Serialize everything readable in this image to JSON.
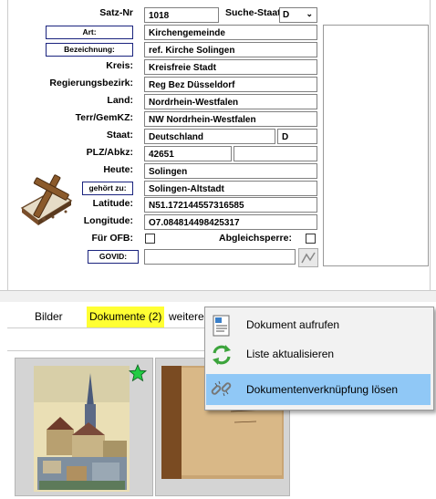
{
  "form": {
    "satznr_label": "Satz-Nr",
    "satznr_value": "1018",
    "suche_label": "Suche-Staat",
    "suche_value": "D",
    "art_button": "Art:",
    "art_value": "Kirchengemeinde",
    "bezeichnung_button": "Bezeichnung:",
    "bezeichnung_value": "ref. Kirche  Solingen",
    "kreis_label": "Kreis:",
    "kreis_value": "Kreisfreie Stadt",
    "regbez_label": "Regierungsbezirk:",
    "regbez_value": "Reg Bez Düsseldorf",
    "land_label": "Land:",
    "land_value": "Nordrhein-Westfalen",
    "terr_label": "Terr/GemKZ:",
    "terr_value": "NW  Nordrhein-Westfalen",
    "staat_label": "Staat:",
    "staat_value": "Deutschland",
    "staat_code": "D",
    "plz_label": "PLZ/Abkz:",
    "plz_value": "42651",
    "plz_abkz": "",
    "heute_label": "Heute:",
    "heute_value": "Solingen",
    "gehoert_button": "gehört zu:",
    "gehoert_value": "Solingen-Altstadt",
    "lat_label": "Latitude:",
    "lat_value": "N51.172144557316585",
    "lon_label": "Longitude:",
    "lon_value": "O7.084814498425317",
    "ofb_label": "Für OFB:",
    "abgleich_label": "Abgleichsperre:",
    "govid_button": "GOVID:",
    "govid_value": ""
  },
  "tabs": [
    {
      "label": "Bilder"
    },
    {
      "label": "Dokumente (2)"
    },
    {
      "label": "weitere"
    }
  ],
  "context_menu": [
    {
      "label": "Dokument aufrufen",
      "icon": "document-icon"
    },
    {
      "label": "Liste aktualisieren",
      "icon": "refresh-icon"
    },
    {
      "label": "Dokumentenverknüpfung lösen",
      "icon": "unlink-icon"
    }
  ],
  "colors": {
    "active_tab": "#ffff33",
    "menu_highlight": "#90c8f6",
    "star": "#22cc44"
  }
}
